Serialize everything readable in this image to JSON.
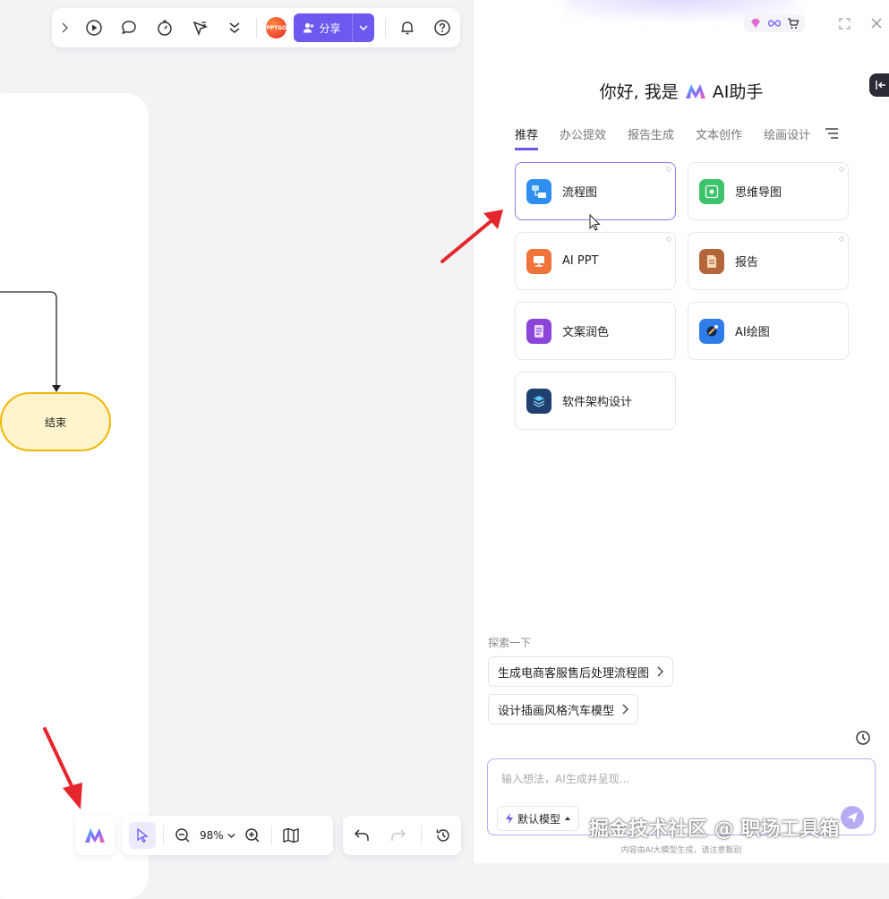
{
  "canvas": {
    "end_node_label": "结束"
  },
  "topbar": {
    "pptgo_badge": "PPTGO",
    "share_label": "分享"
  },
  "bottom_bar": {
    "zoom_level": "98%"
  },
  "panel": {
    "greeting_prefix": "你好, 我是",
    "greeting_suffix": "AI助手",
    "tabs": [
      {
        "label": "推荐",
        "active": true
      },
      {
        "label": "办公提效",
        "active": false
      },
      {
        "label": "报告生成",
        "active": false
      },
      {
        "label": "文本创作",
        "active": false
      },
      {
        "label": "绘画设计",
        "active": false
      }
    ],
    "cards": [
      {
        "label": "流程图",
        "icon": "flowchart-icon",
        "color": "#2f8ff0"
      },
      {
        "label": "思维导图",
        "icon": "mindmap-icon",
        "color": "#3cc46a"
      },
      {
        "label": "AI PPT",
        "icon": "ppt-icon",
        "color": "#f0733a"
      },
      {
        "label": "报告",
        "icon": "report-icon",
        "color": "#b5653a"
      },
      {
        "label": "文案润色",
        "icon": "copywriting-icon",
        "color": "#8b45d8"
      },
      {
        "label": "AI绘图",
        "icon": "ai-drawing-icon",
        "color": "#2f7de8"
      },
      {
        "label": "软件架构设计",
        "icon": "architecture-icon",
        "color": "#1f3f6e"
      }
    ],
    "explore_label": "探索一下",
    "suggestions": [
      "生成电商客服售后处理流程图",
      "设计插画风格汽车模型"
    ],
    "input_placeholder": "输入想法，AI生成并呈现...",
    "model_label": "默认模型",
    "disclaimer": "内容由AI大模型生成，请注意甄别"
  },
  "watermark": "掘金技术社区 @ 职场工具箱",
  "colors": {
    "accent": "#6d59f0",
    "node_fill": "#fff4cc",
    "node_border": "#f2b705",
    "annotation_arrow": "#e5262d"
  }
}
